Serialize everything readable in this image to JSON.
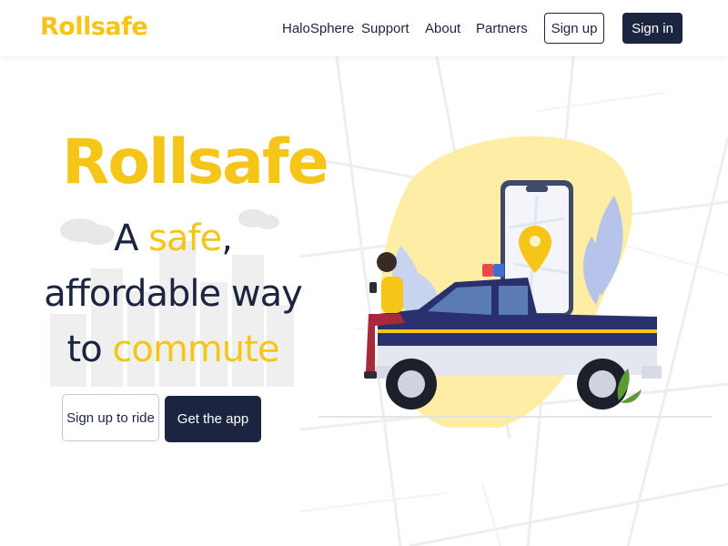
{
  "header": {
    "logo": "Rollsafe",
    "nav": [
      "HaloSphere",
      "Support",
      "About",
      "Partners"
    ],
    "signup_label": "Sign up",
    "signin_label": "Sign in"
  },
  "hero": {
    "brand": "Rollsafe",
    "tagline": {
      "line1_a": "A ",
      "line1_hl": "safe",
      "line1_b": ",",
      "line2": "affordable way",
      "line3_a": "to ",
      "line3_hl": "commute"
    },
    "cta_signup": "Sign up to ride",
    "cta_app": "Get the app"
  },
  "colors": {
    "brand_yellow": "#f5c518",
    "navy": "#1c2540",
    "truck_blue": "#2a2f6e"
  },
  "icons": [
    "map-pin-icon"
  ]
}
